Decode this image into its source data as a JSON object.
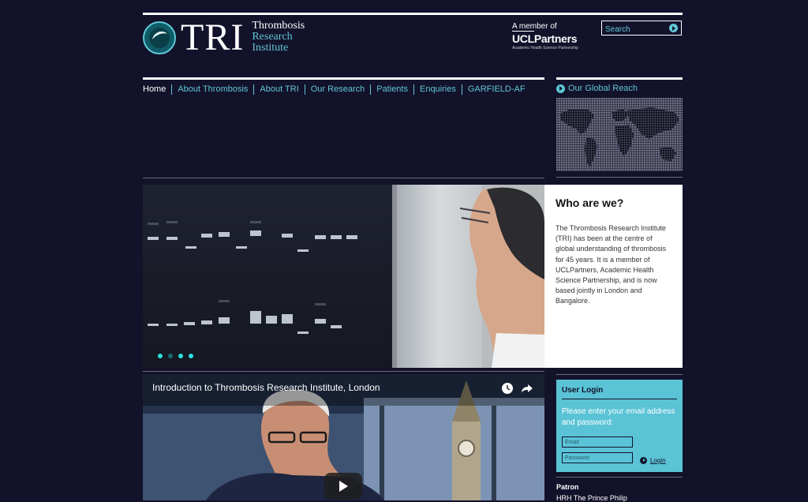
{
  "logo": {
    "mark_text": "TRI",
    "word1": "Thrombosis",
    "word2": "Research",
    "word3": "Institute"
  },
  "member": {
    "label": "A member of",
    "partner_prefix": "UCL",
    "partner_name": "Partners",
    "partner_sub": "Academic Health Science Partnership"
  },
  "search": {
    "placeholder": "Search"
  },
  "nav": {
    "items": [
      "Home",
      "About Thrombosis",
      "About TRI",
      "Our Research",
      "Patients",
      "Enquiries",
      "GARFIELD-AF"
    ]
  },
  "global_reach": {
    "label": "Our Global Reach"
  },
  "who": {
    "title": "Who are we?",
    "body": "The Thrombosis Research Institute (TRI) has been at the centre of global understanding of thrombosis for 45 years. It is a member of UCLPartners, Academic Health Science Partnership, and is now based jointly in London and Bangalore."
  },
  "video": {
    "title": "Introduction to Thrombosis Research Institute, London"
  },
  "login": {
    "title": "User Login",
    "prompt": "Please enter your email address and password:",
    "email_placeholder": "Email",
    "password_placeholder": "Password",
    "button": "Login"
  },
  "patron": {
    "title": "Patron",
    "name": "HRH The Prince Philip"
  },
  "colors": {
    "background": "#13122b",
    "accent": "#5fc7d4",
    "login_panel": "#5ac3d6"
  }
}
